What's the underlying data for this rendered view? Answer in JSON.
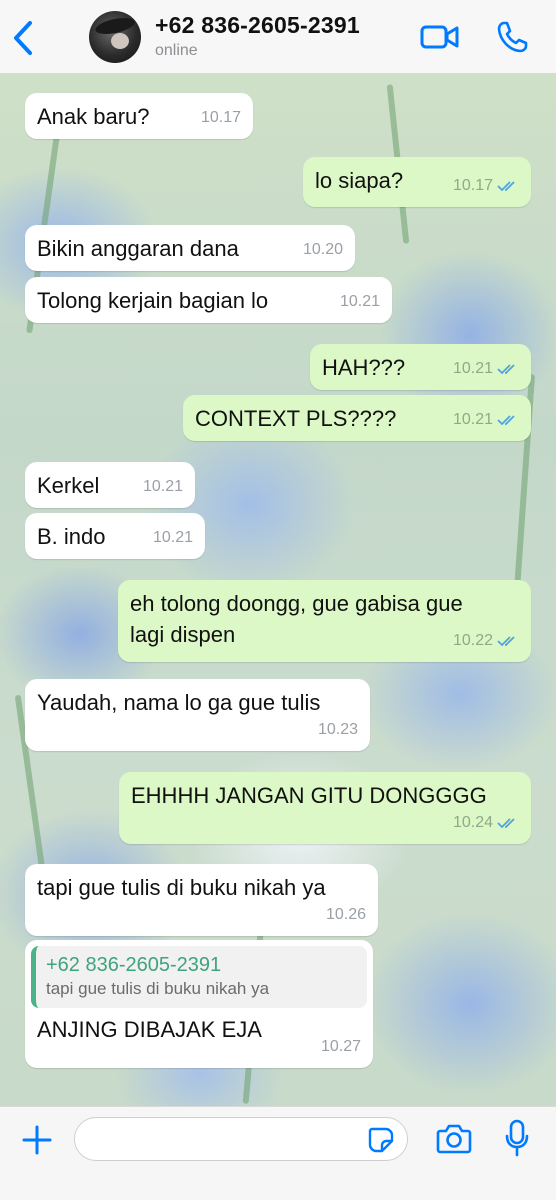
{
  "header": {
    "contact_name": "+62 836-2605-2391",
    "status": "online"
  },
  "messages": [
    {
      "direction": "in",
      "text": "Anak baru?",
      "time": "10.17"
    },
    {
      "direction": "out",
      "text": "lo siapa?",
      "time": "10.17"
    },
    {
      "direction": "in",
      "text": "Bikin anggaran dana",
      "time": "10.20"
    },
    {
      "direction": "in",
      "text": "Tolong kerjain bagian lo",
      "time": "10.21"
    },
    {
      "direction": "out",
      "text": "HAH???",
      "time": "10.21"
    },
    {
      "direction": "out",
      "text": "CONTEXT PLS????",
      "time": "10.21"
    },
    {
      "direction": "in",
      "text": "Kerkel",
      "time": "10.21"
    },
    {
      "direction": "in",
      "text": "B. indo",
      "time": "10.21"
    },
    {
      "direction": "out",
      "text": "eh tolong doongg, gue gabisa gue\nlagi dispen",
      "time": "10.22"
    },
    {
      "direction": "in",
      "text": "Yaudah, nama lo ga gue tulis",
      "time": "10.23"
    },
    {
      "direction": "out",
      "text": "EHHHH JANGAN GITU DONGGGG",
      "time": "10.24"
    },
    {
      "direction": "in",
      "text": "tapi gue tulis di buku nikah ya",
      "time": "10.26"
    },
    {
      "direction": "in",
      "text": "ANJING DIBAJAK EJA",
      "time": "10.27",
      "reply": {
        "name": "+62 836-2605-2391",
        "text": "tapi gue tulis di buku nikah ya"
      }
    }
  ],
  "composer": {
    "input_value": ""
  },
  "colors": {
    "accent": "#007aff",
    "outgoing_bubble": "#dcf8c6",
    "incoming_bubble": "#ffffff",
    "read_ticks": "#4fa3e0",
    "reply_name": "#3fa37d"
  },
  "icons": {
    "back": "chevron-left-icon",
    "video": "video-camera-icon",
    "call": "phone-icon",
    "add": "plus-icon",
    "sticker": "sticker-icon",
    "camera": "camera-icon",
    "mic": "microphone-icon",
    "read": "double-check-icon"
  }
}
